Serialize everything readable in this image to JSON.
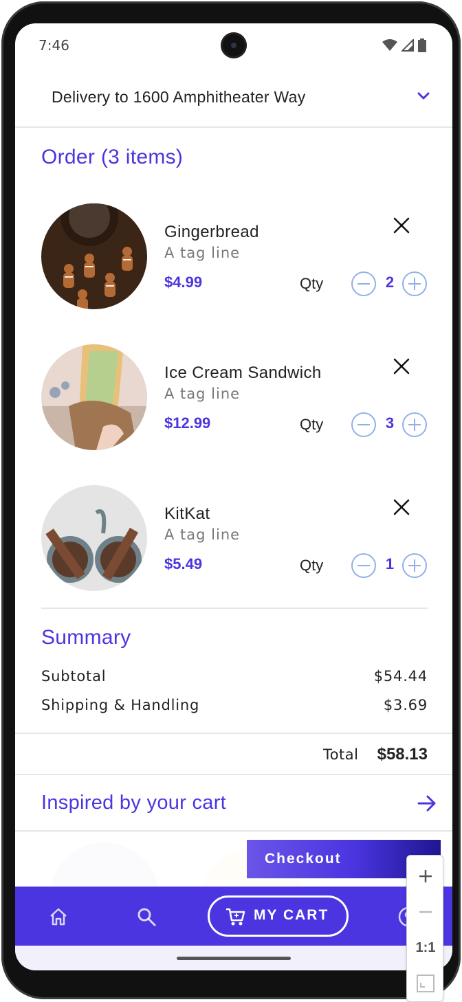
{
  "status_bar": {
    "time": "7:46"
  },
  "header": {
    "delivery_text": "Delivery to 1600 Amphitheater Way"
  },
  "order": {
    "title": "Order (3 items)",
    "qty_label": "Qty",
    "items": [
      {
        "name": "Gingerbread",
        "tagline": "A tag line",
        "price": "$4.99",
        "qty": "2"
      },
      {
        "name": "Ice Cream Sandwich",
        "tagline": "A tag line",
        "price": "$12.99",
        "qty": "3"
      },
      {
        "name": "KitKat",
        "tagline": "A tag line",
        "price": "$5.49",
        "qty": "1"
      }
    ]
  },
  "summary": {
    "title": "Summary",
    "subtotal_label": "Subtotal",
    "subtotal_value": "$54.44",
    "shipping_label": "Shipping & Handling",
    "shipping_value": "$3.69",
    "total_label": "Total",
    "total_value": "$58.13"
  },
  "inspired": {
    "title": "Inspired by your cart"
  },
  "checkout": {
    "label": "Checkout"
  },
  "bottom_nav": {
    "items": [
      "home-icon",
      "search-icon",
      "cart-icon",
      "profile-icon"
    ],
    "cart_label": "MY CART"
  },
  "zoom_control": {
    "fit_label": "1:1"
  },
  "colors": {
    "accent": "#4a35e0",
    "qty_button": "#8fb0ea",
    "text": "#222222",
    "muted": "#777777"
  }
}
